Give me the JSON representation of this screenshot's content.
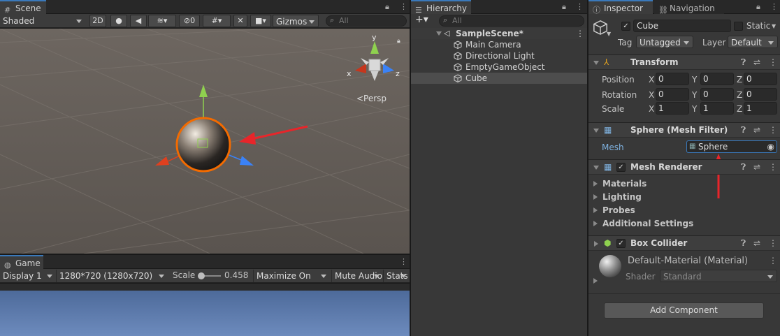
{
  "scene": {
    "tab_label": "Scene",
    "shading_mode": "Shaded",
    "mode_2d": "2D",
    "hidden_count": "0",
    "gizmos_label": "Gizmos",
    "search_placeholder": "All",
    "persp_label": "<Persp",
    "axis_y": "y",
    "axis_x": "x",
    "axis_z": "z"
  },
  "game": {
    "tab_label": "Game",
    "display": "Display 1",
    "resolution": "1280*720 (1280x720)",
    "scale_label": "Scale",
    "scale_value": "0.458",
    "scale_level": 0.05,
    "maximize_label": "Maximize On Play",
    "mute_label": "Mute Audio",
    "stats_label": "Stats"
  },
  "hierarchy": {
    "tab_label": "Hierarchy",
    "add_label": "+▾",
    "search_placeholder": "All",
    "scene_name": "SampleScene*",
    "items": [
      "Main Camera",
      "Directional Light",
      "EmptyGameObject",
      "Cube"
    ]
  },
  "inspector": {
    "tab_label": "Inspector",
    "nav_tab_label": "Navigation",
    "object_name": "Cube",
    "static_label": "Static",
    "tag_label": "Tag",
    "tag_value": "Untagged",
    "layer_label": "Layer",
    "layer_value": "Default",
    "transform": {
      "title": "Transform",
      "rows": [
        {
          "label": "Position",
          "x": "0",
          "y": "0",
          "z": "0"
        },
        {
          "label": "Rotation",
          "x": "0",
          "y": "0",
          "z": "0"
        },
        {
          "label": "Scale",
          "x": "1",
          "y": "1",
          "z": "1"
        }
      ],
      "axis_x": "X",
      "axis_y": "Y",
      "axis_z": "Z"
    },
    "mesh_filter": {
      "title": "Sphere (Mesh Filter)",
      "mesh_label": "Mesh",
      "mesh_value": "Sphere"
    },
    "mesh_renderer": {
      "title": "Mesh Renderer",
      "sections": [
        "Materials",
        "Lighting",
        "Probes",
        "Additional Settings"
      ]
    },
    "box_collider": {
      "title": "Box Collider"
    },
    "material": {
      "name": "Default-Material (Material)",
      "shader_label": "Shader",
      "shader_value": "Standard"
    },
    "add_component_label": "Add Component"
  },
  "colors": {
    "accent": "#3a79bb",
    "selection": "#4d4d4d",
    "annotation_arrow": "#e8252a",
    "selection_outline": "#f36b00"
  }
}
